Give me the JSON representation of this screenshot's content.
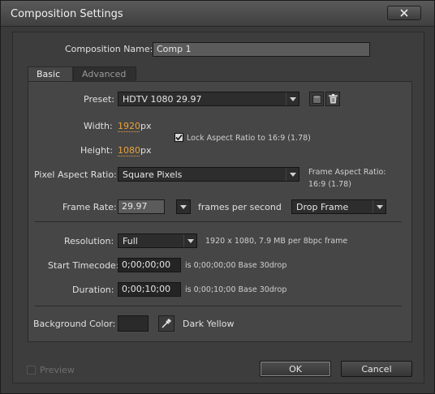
{
  "window": {
    "title": "Composition Settings"
  },
  "composition": {
    "name_label": "Composition Name:",
    "name_value": "Comp 1"
  },
  "tabs": [
    {
      "label": "Basic",
      "selected": true
    },
    {
      "label": "Advanced",
      "selected": false
    }
  ],
  "basic": {
    "preset_label": "Preset:",
    "preset_value": "HDTV 1080 29.97",
    "width_label": "Width:",
    "width_value": "1920",
    "width_unit": "px",
    "height_label": "Height:",
    "height_value": "1080",
    "height_unit": "px",
    "lock_aspect_label": "Lock Aspect Ratio to 16:9 (1.78)",
    "lock_aspect_checked": true,
    "par_label": "Pixel Aspect Ratio:",
    "par_value": "Square Pixels",
    "frame_aspect_label": "Frame Aspect Ratio:",
    "frame_aspect_value": "16:9 (1.78)",
    "frame_rate_label": "Frame Rate:",
    "frame_rate_value": "29.97",
    "frame_rate_unit": "frames per second",
    "drop_frame_value": "Drop Frame",
    "resolution_label": "Resolution:",
    "resolution_value": "Full",
    "resolution_info": "1920 x 1080, 7.9 MB per 8bpc frame",
    "start_tc_label": "Start Timecode:",
    "start_tc_value": "0;00;00;00",
    "start_tc_info": "is 0;00;00;00  Base 30drop",
    "duration_label": "Duration:",
    "duration_value": "0;00;10;00",
    "duration_info": "is 0;00;10;00  Base 30drop",
    "bg_color_label": "Background Color:",
    "bg_color_hex": "#2a2a2a",
    "bg_color_name": "Dark Yellow"
  },
  "footer": {
    "preview_label": "Preview",
    "ok_label": "OK",
    "cancel_label": "Cancel"
  },
  "colors": {
    "accent": "#e8a238"
  },
  "icons": [
    "close-icon",
    "save-preset-icon",
    "delete-preset-icon",
    "dropdown-arrow-icon",
    "eyedropper-icon",
    "checkmark-icon"
  ]
}
